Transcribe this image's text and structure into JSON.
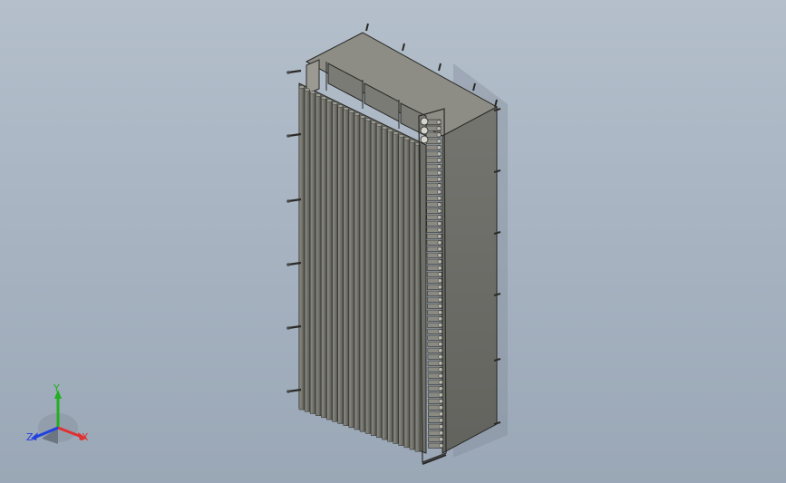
{
  "viewport": {
    "background_top": "#b4bfcb",
    "background_bottom": "#9aa7b6"
  },
  "model": {
    "name": "",
    "colors": {
      "top": "#8d8d86",
      "side": "#6e6e68",
      "front": "#7b7b74",
      "edge": "#2a2a27",
      "fin_light": "#8a8a83",
      "fin_dark": "#5c5c57"
    },
    "icons": [
      "rack-assembly",
      "triad-axis-icon"
    ]
  },
  "triad": {
    "x_label": "X",
    "y_label": "Y",
    "z_label": "Z",
    "x_color": "#e03030",
    "y_color": "#20b020",
    "z_color": "#2040e0"
  }
}
